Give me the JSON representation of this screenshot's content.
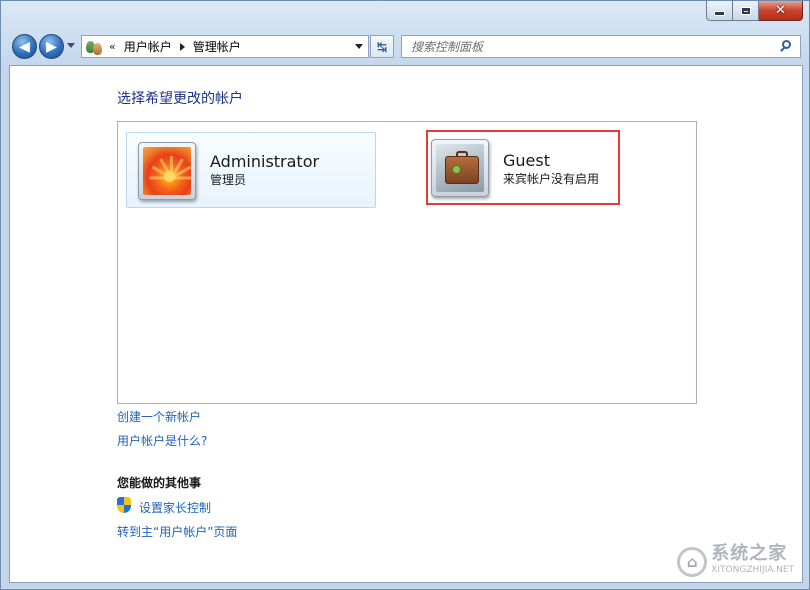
{
  "nav": {
    "back_label": "",
    "forward_label": ""
  },
  "address": {
    "overflow": "«",
    "crumbs": [
      "用户帐户",
      "管理帐户"
    ]
  },
  "search": {
    "placeholder": "搜索控制面板"
  },
  "main": {
    "title": "选择希望更改的帐户",
    "accounts": [
      {
        "name": "Administrator",
        "role": "管理员",
        "avatar": "flower"
      },
      {
        "name": "Guest",
        "role": "来宾帐户没有启用",
        "avatar": "suitcase",
        "highlighted": true
      }
    ],
    "links": {
      "create": "创建一个新帐户",
      "what_is": "用户帐户是什么?"
    },
    "other_heading": "您能做的其他事",
    "other_links": {
      "parental": "设置家长控制",
      "main_page": "转到主“用户帐户”页面"
    }
  },
  "watermark": {
    "cn": "系统之家",
    "en": "XITONGZHIJIA.NET"
  },
  "colors": {
    "highlight": "#e03c3c",
    "link": "#1f63b8",
    "title": "#1e3287"
  }
}
